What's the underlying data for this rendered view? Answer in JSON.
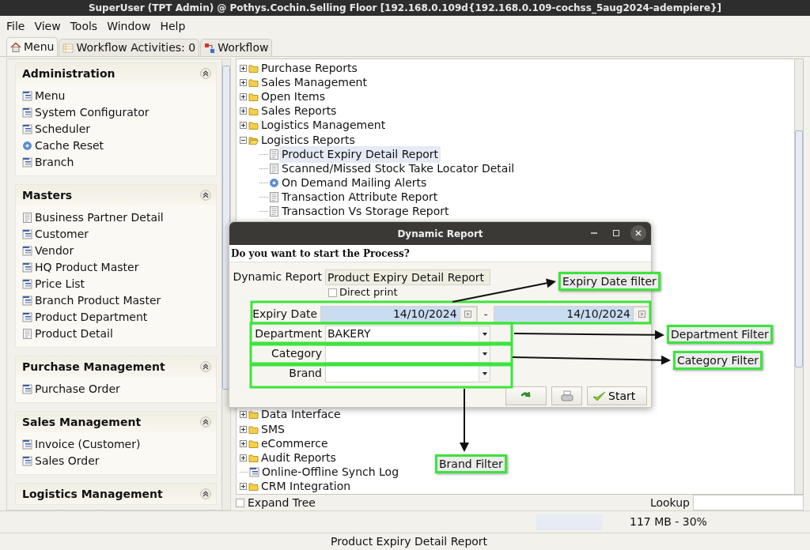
{
  "window": {
    "title": "SuperUser (TPT Admin) @ Pothys.Cochin.Selling Floor [192.168.0.109d{192.168.0.109-cochss_5aug2024-adempiere}]"
  },
  "menu_bar": [
    "File",
    "View",
    "Tools",
    "Window",
    "Help"
  ],
  "tabs": [
    {
      "label": "Menu",
      "kind": "home",
      "selected": true
    },
    {
      "label": "Workflow Activities: 0",
      "kind": "list",
      "selected": false
    },
    {
      "label": "Workflow",
      "kind": "workflow",
      "selected": false
    }
  ],
  "sidebar": {
    "sections": [
      {
        "title": "Administration",
        "expanded": true,
        "items": [
          {
            "label": "Menu",
            "kind": "window"
          },
          {
            "label": "System Configurator",
            "kind": "window"
          },
          {
            "label": "Scheduler",
            "kind": "window"
          },
          {
            "label": "Cache Reset",
            "kind": "process"
          },
          {
            "label": "Branch",
            "kind": "window"
          }
        ]
      },
      {
        "title": "Masters",
        "expanded": true,
        "items": [
          {
            "label": "Business Partner Detail",
            "kind": "report"
          },
          {
            "label": "Customer",
            "kind": "window"
          },
          {
            "label": "Vendor",
            "kind": "window"
          },
          {
            "label": "HQ Product Master",
            "kind": "window"
          },
          {
            "label": "Price List",
            "kind": "window"
          },
          {
            "label": "Branch Product Master",
            "kind": "window"
          },
          {
            "label": "Product Department",
            "kind": "window"
          },
          {
            "label": "Product Detail",
            "kind": "report"
          }
        ]
      },
      {
        "title": "Purchase Management",
        "expanded": true,
        "items": [
          {
            "label": "Purchase Order",
            "kind": "window"
          }
        ]
      },
      {
        "title": "Sales Management",
        "expanded": true,
        "items": [
          {
            "label": "Invoice (Customer)",
            "kind": "window"
          },
          {
            "label": "Sales Order",
            "kind": "window"
          }
        ]
      },
      {
        "title": "Logistics Management",
        "expanded": true
      }
    ]
  },
  "tree": {
    "items": [
      {
        "label": "Purchase Reports",
        "kind": "folder",
        "expanded": false
      },
      {
        "label": "Sales Management",
        "kind": "folder",
        "expanded": false
      },
      {
        "label": "Open Items",
        "kind": "folder",
        "expanded": false
      },
      {
        "label": "Sales Reports",
        "kind": "folder",
        "expanded": false
      },
      {
        "label": "Logistics Management",
        "kind": "folder",
        "expanded": false
      },
      {
        "label": "Logistics Reports",
        "kind": "folder",
        "expanded": true,
        "children": [
          {
            "label": "Product Expiry Detail Report",
            "kind": "report",
            "selected": true
          },
          {
            "label": "Scanned/Missed Stock Take Locator Detail",
            "kind": "report",
            "selected": false
          },
          {
            "label": "On Demand Mailing Alerts",
            "kind": "process",
            "selected": false
          },
          {
            "label": "Transaction Attribute Report",
            "kind": "report",
            "selected": false
          },
          {
            "label": "Transaction Vs Storage Report",
            "kind": "report",
            "selected": false
          }
        ]
      },
      {
        "label": "Data Interface",
        "kind": "folder",
        "expanded": false
      },
      {
        "label": "SMS",
        "kind": "folder",
        "expanded": false
      },
      {
        "label": "eCommerce",
        "kind": "folder",
        "expanded": false
      },
      {
        "label": "Audit Reports",
        "kind": "folder",
        "expanded": false
      },
      {
        "label": "Online-Offline Synch Log",
        "kind": "window",
        "selected": false
      },
      {
        "label": "CRM Integration",
        "kind": "folder",
        "expanded": false
      }
    ]
  },
  "expand_tree": {
    "label": "Expand Tree",
    "checked": false
  },
  "lookup": {
    "label": "Lookup"
  },
  "memory": "117 MB - 30%",
  "status_line": "Product Expiry Detail Report",
  "dialog": {
    "title": "Dynamic Report",
    "message": "Do you want to start the Process?",
    "report": {
      "label": "Dynamic Report",
      "value": "Product Expiry Detail Report"
    },
    "direct_print": {
      "label": "Direct print",
      "checked": false
    },
    "fields": [
      {
        "label": "Expiry Date",
        "kind": "date_range",
        "separator": "-",
        "from": "14/10/2024",
        "to": "14/10/2024"
      },
      {
        "label": "Department",
        "kind": "combo",
        "value": "BAKERY"
      },
      {
        "label": "Category",
        "kind": "combo"
      },
      {
        "label": "Brand",
        "kind": "combo"
      }
    ],
    "start_button": "Start"
  },
  "annotations": [
    {
      "label": "Expiry Date filter"
    },
    {
      "label": "Department Filter"
    },
    {
      "label": "Category Filter"
    },
    {
      "label": "Brand Filter"
    }
  ]
}
